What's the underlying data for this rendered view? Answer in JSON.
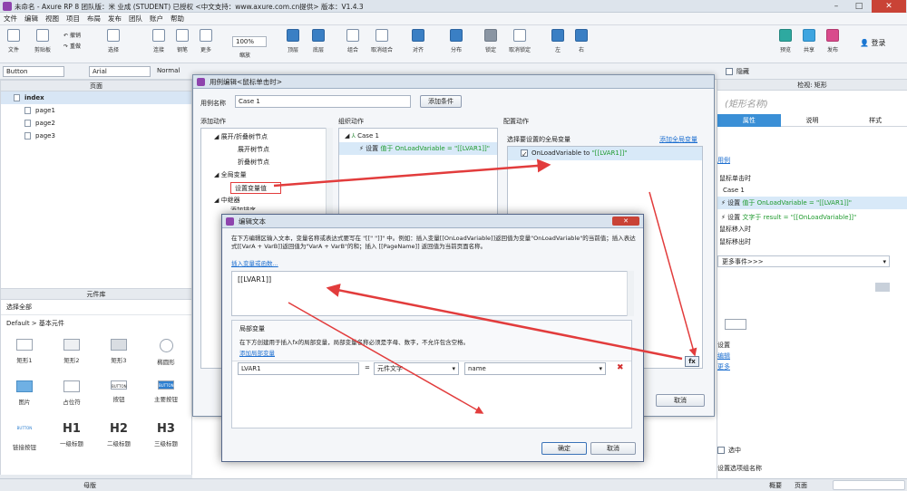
{
  "window": {
    "title": "未命名 - Axure RP 8 团队版：米 业成 (STUDENT) 已授权      <中文支持：www.axure.com.cn提供> 版本：V1.4.3"
  },
  "menu": [
    "文件",
    "编辑",
    "视图",
    "项目",
    "布局",
    "发布",
    "团队",
    "账户",
    "帮助"
  ],
  "toolbar": {
    "file": "文件",
    "clipboard": "剪贴板",
    "undo": "撤销",
    "redo": "重做",
    "select": "选择",
    "connect": "连接",
    "pen": "钢笔",
    "more": "更多",
    "zoom_value": "100%",
    "zoom": "缩放",
    "top": "顶层",
    "bottom": "底层",
    "group": "组合",
    "ungroup": "取消组合",
    "align": "对齐",
    "distribute": "分布",
    "lock": "锁定",
    "unlock": "取消锁定",
    "left": "左",
    "right": "右",
    "preview": "预览",
    "share": "共享",
    "publish": "发布",
    "login": "登录"
  },
  "format": {
    "widget": "Button",
    "font": "Arial",
    "style": "Normal",
    "hide": "隐藏"
  },
  "pages": {
    "header": "页面",
    "items": [
      "index",
      "page1",
      "page2",
      "page3"
    ]
  },
  "library": {
    "header": "元件库",
    "select_all": "选择全部",
    "category": "Default > 基本元件",
    "items": [
      "矩形1",
      "矩形2",
      "矩形3",
      "椭圆形",
      "图片",
      "占位符",
      "按钮",
      "主要按钮",
      "链接按钮",
      "一级标题",
      "二级标题",
      "三级标题"
    ],
    "h1": "H1",
    "h2": "H2",
    "h3": "H3",
    "btn_small": "BUTTON"
  },
  "masters": {
    "header": "母版"
  },
  "rightpanel": {
    "header": "检视: 矩形",
    "name_placeholder": "(矩形名称)",
    "tabs": [
      "属性",
      "说明",
      "样式"
    ],
    "use_case": "用例",
    "on_click": "鼠标单击时",
    "case1": "Case 1",
    "action1_prefix": "设置",
    "action1": "值于 OnLoadVariable = \"[[LVAR1]]\"",
    "action2_prefix": "设置",
    "action2": "文字于 result = \"[[OnLoadVariable]]\"",
    "mouse_in": "鼠标移入时",
    "mouse_out": "鼠标移出时",
    "more_events": "更多事件>>>",
    "set": "设置",
    "edit_link": "编辑",
    "more_link": "更多",
    "selected": "选中",
    "set_group": "设置选项组名称",
    "footer_overview": "概要",
    "footer_pages": "页面"
  },
  "case_dialog": {
    "title": "用例编辑<鼠标单击时>",
    "case_name_label": "用例名称",
    "case_name": "Case 1",
    "add_condition": "添加条件",
    "col_add": "添加动作",
    "col_organize": "组织动作",
    "col_config": "配置动作",
    "tree": [
      "展开/折叠树节点",
      "展开树节点",
      "折叠树节点",
      "全局变量",
      "设置变量值",
      "中继器",
      "添加排序"
    ],
    "org_case": "Case 1",
    "org_action_prefix": "设置",
    "org_action": "值于 OnLoadVariable = \"[[LVAR1]]\"",
    "select_var_label": "选择要设置的全局变量",
    "add_global_link": "添加全局变量",
    "var_row_name": "OnLoadVariable to",
    "var_row_value": "\"[[LVAR1]]\"",
    "cancel": "取消"
  },
  "text_dialog": {
    "title": "编辑文本",
    "instructions": "在下方编辑区输入文本，变量名称或表达式要写在 \"[[\" \"]]\" 中。例如：插入变量[[OnLoadVariable]]返回值为变量\"OnLoadVariable\"的当前值；插入表达式[[VarA + VarB]]返回值为\"VarA + VarB\"的和；插入 [[PageName]] 返回值为当前页面名称。",
    "insert_link": "插入变量或函数...",
    "editor_value": "[[LVAR1]]",
    "local_header": "局部变量",
    "local_desc": "在下方创建用于插入fx的局部变量，局部变量名称必须是字母、数字，不允许包含空格。",
    "add_local_link": "添加局部变量",
    "var_name": "LVAR1",
    "equals": "=",
    "var_type": "元件文字",
    "var_target": "name",
    "ok": "确定",
    "cancel": "取消",
    "fx": "fx"
  },
  "colors": {
    "accent": "#3a8fd6",
    "arrow": "#e23c3c",
    "green_text": "#1e9a2d",
    "link": "#1d6fd0"
  }
}
